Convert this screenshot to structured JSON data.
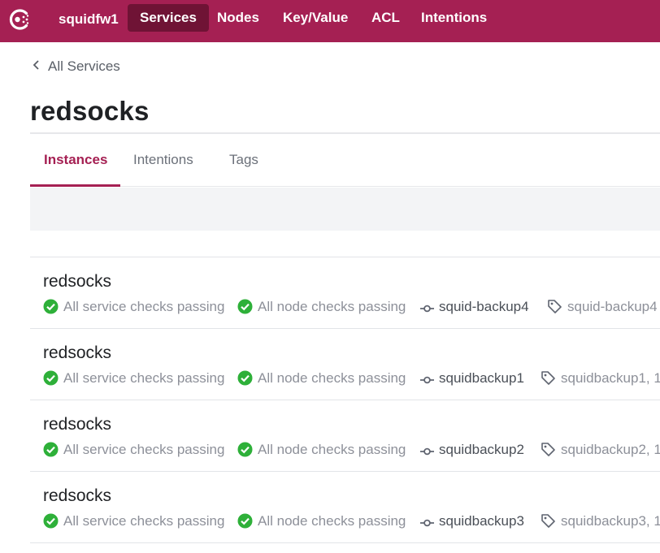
{
  "app": {
    "datacenter": "squidfw1"
  },
  "nav": [
    {
      "label": "Services",
      "active": true
    },
    {
      "label": "Nodes",
      "active": false
    },
    {
      "label": "Key/Value",
      "active": false
    },
    {
      "label": "ACL",
      "active": false
    },
    {
      "label": "Intentions",
      "active": false
    }
  ],
  "breadcrumb": {
    "label": "All Services"
  },
  "page": {
    "title": "redsocks"
  },
  "tabs": [
    {
      "label": "Instances",
      "active": true
    },
    {
      "label": "Intentions",
      "active": false
    },
    {
      "label": "Tags",
      "active": false
    }
  ],
  "instances": [
    {
      "name": "redsocks",
      "service_checks": "All service checks passing",
      "node_checks": "All node checks passing",
      "node": "squid-backup4",
      "tags": "squid-backup4"
    },
    {
      "name": "redsocks",
      "service_checks": "All service checks passing",
      "node_checks": "All node checks passing",
      "node": "squidbackup1",
      "tags": "squidbackup1, 1"
    },
    {
      "name": "redsocks",
      "service_checks": "All service checks passing",
      "node_checks": "All node checks passing",
      "node": "squidbackup2",
      "tags": "squidbackup2, 1"
    },
    {
      "name": "redsocks",
      "service_checks": "All service checks passing",
      "node_checks": "All node checks passing",
      "node": "squidbackup3",
      "tags": "squidbackup3, 1"
    }
  ],
  "colors": {
    "brand": "#a52053",
    "brand_dark": "#6f1335",
    "passing": "#2eb039"
  }
}
